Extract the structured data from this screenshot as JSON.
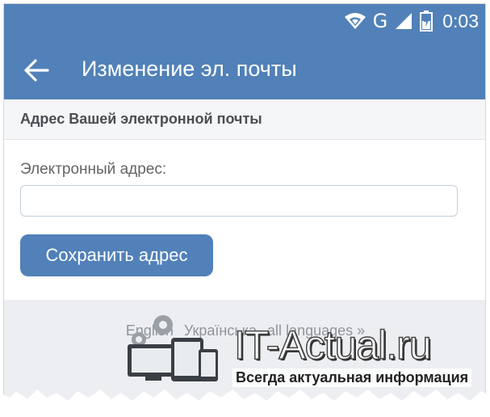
{
  "status_bar": {
    "network": "G",
    "time": "0:03"
  },
  "header": {
    "title": "Изменение эл. почты"
  },
  "section": {
    "heading": "Адрес Вашей электронной почты"
  },
  "form": {
    "email_label": "Электронный адрес:",
    "email_value": "",
    "save_label": "Сохранить адрес"
  },
  "footer": {
    "languages": [
      "English",
      "Українська",
      "all languages »"
    ]
  },
  "watermark": {
    "brand": "IT-Actual.ru",
    "tagline": "Всегда актуальная информация"
  },
  "colors": {
    "accent": "#5181b8",
    "background": "#f0f2f5"
  },
  "icons": [
    "wifi-icon",
    "signal-icon",
    "battery-icon",
    "back-arrow-icon"
  ]
}
